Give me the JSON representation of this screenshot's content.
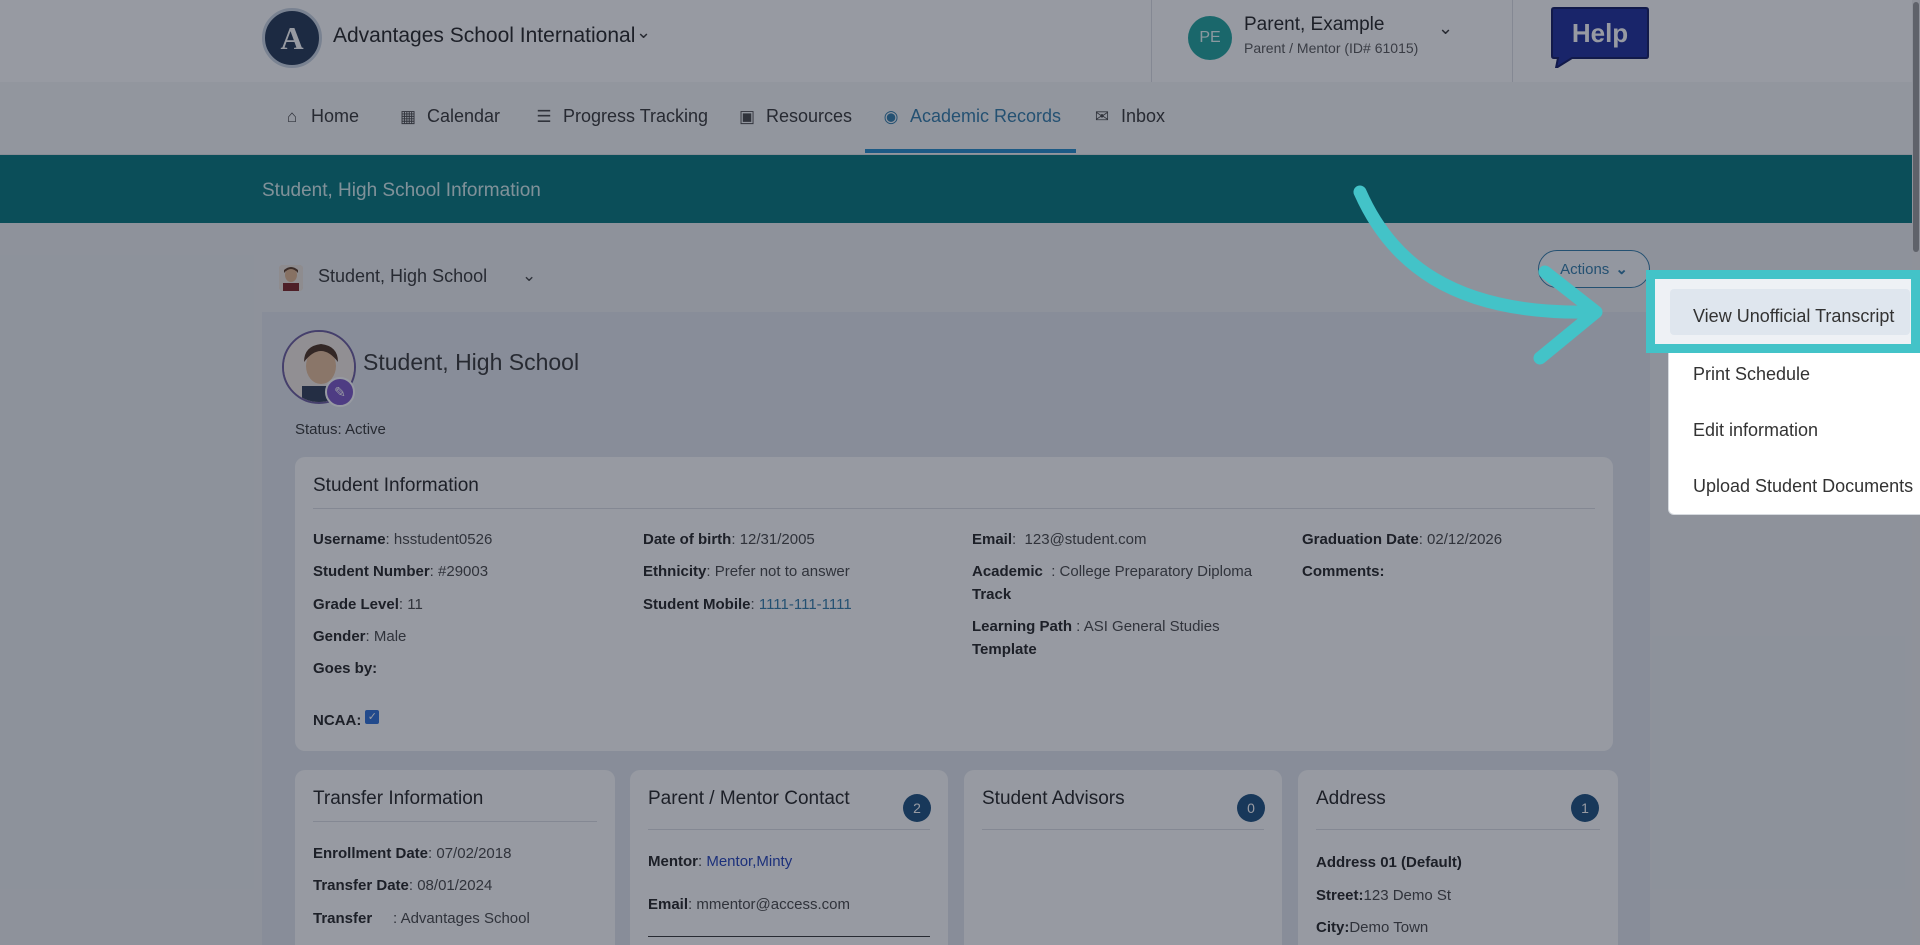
{
  "header": {
    "school_logo_letter": "A",
    "school_name": "Advantages School International",
    "user_initials": "PE",
    "user_name": "Parent, Example",
    "user_role": "Parent / Mentor (ID# 61015)",
    "help_label": "Help"
  },
  "nav": {
    "items": [
      {
        "label": "Home",
        "icon": "home-icon"
      },
      {
        "label": "Calendar",
        "icon": "calendar-icon"
      },
      {
        "label": "Progress Tracking",
        "icon": "progress-icon"
      },
      {
        "label": "Resources",
        "icon": "inbox-tray-icon"
      },
      {
        "label": "Academic Records",
        "icon": "user-circle-icon",
        "active": true
      },
      {
        "label": "Inbox",
        "icon": "envelope-icon"
      }
    ]
  },
  "page": {
    "title": "Student, High School Information",
    "student_selector": "Student, High School",
    "actions_label": "Actions"
  },
  "profile": {
    "name": "Student, High School",
    "status": "Status: Active"
  },
  "student_info": {
    "title": "Student Information",
    "username_label": "Username",
    "username": "hsstudent0526",
    "student_number_label": "Student Number",
    "student_number": "#29003",
    "grade_level_label": "Grade Level",
    "grade_level": "11",
    "gender_label": "Gender",
    "gender": "Male",
    "goes_by_label": "Goes by:",
    "ncaa_label": "NCAA:",
    "dob_label": "Date of birth",
    "dob": "12/31/2005",
    "ethnicity_label": "Ethnicity",
    "ethnicity": "Prefer not to answer",
    "mobile_label": "Student Mobile",
    "mobile": "1111-111-1111",
    "email_label": "Email",
    "email": "123@student.com",
    "academic_track_label_1": "Academic",
    "academic_track_label_2": "Track",
    "academic_track": "College Preparatory Diploma",
    "learning_path_label_1": "Learning Path",
    "learning_path_label_2": "Template",
    "learning_path": "ASI General Studies",
    "graduation_label": "Graduation Date",
    "graduation": "02/12/2026",
    "comments_label": "Comments:"
  },
  "transfer": {
    "title": "Transfer Information",
    "enrollment_label": "Enrollment Date",
    "enrollment": "07/02/2018",
    "transfer_date_label": "Transfer Date",
    "transfer_date": "08/01/2024",
    "transfer_label": "Transfer",
    "transfer_value": "Advantages School"
  },
  "parent_contact": {
    "title": "Parent / Mentor Contact",
    "count": "2",
    "mentor_label": "Mentor",
    "mentor": "Mentor,Minty",
    "email_label": "Email",
    "email": "mmentor@access.com"
  },
  "advisors": {
    "title": "Student Advisors",
    "count": "0"
  },
  "address": {
    "title": "Address",
    "count": "1",
    "address_title": "Address 01 (Default)",
    "street_label": "Street:",
    "street": "123 Demo St",
    "city_label": "City:",
    "city": "Demo Town"
  },
  "actions_menu": {
    "items": [
      "View Unofficial Transcript",
      "Print Schedule",
      "Edit information",
      "Upload Student Documents"
    ],
    "highlighted": "View Unofficial Transcript"
  },
  "colors": {
    "teal_band": "#00757b",
    "accent_blue": "#2f7aa8",
    "highlight_arrow": "#43c3c8",
    "badge": "#184d7c"
  }
}
